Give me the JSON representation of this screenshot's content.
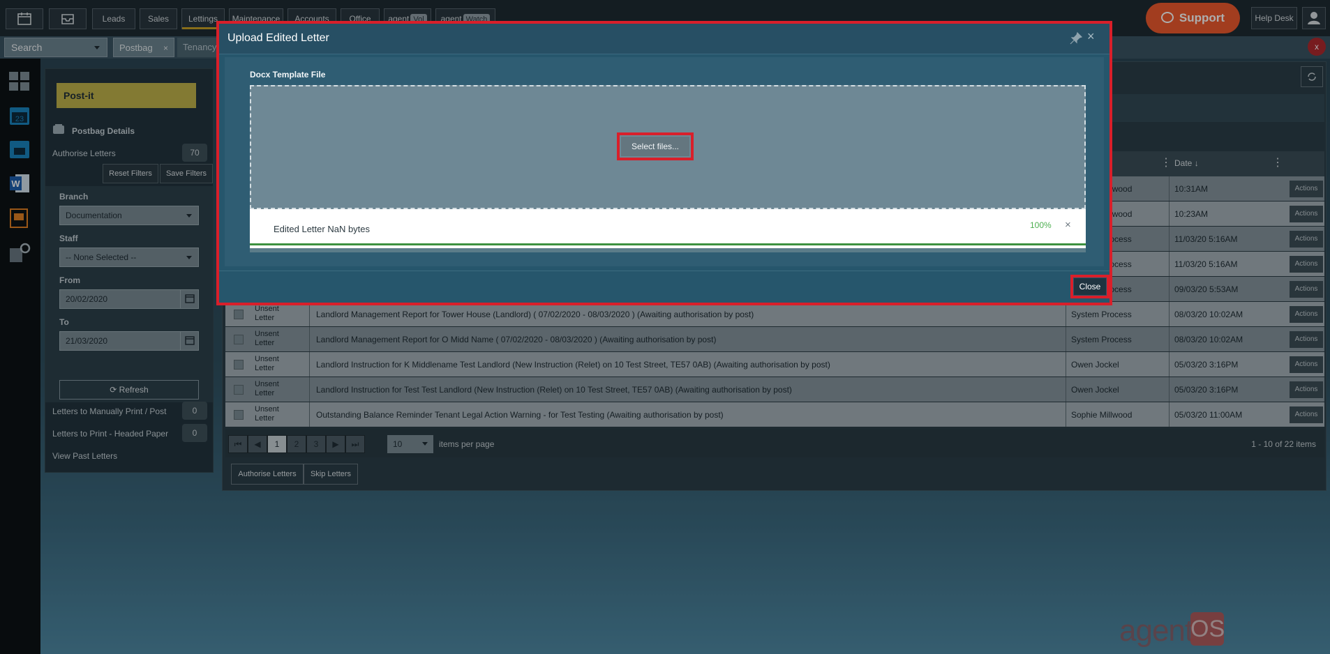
{
  "topnav": {
    "items": [
      {
        "label": ""
      },
      {
        "label": ""
      },
      {
        "label": "Leads"
      },
      {
        "label": "Sales"
      },
      {
        "label": "Lettings"
      },
      {
        "label": "Maintenance"
      },
      {
        "label": "Accounts"
      },
      {
        "label": "Office"
      },
      {
        "label": "agent",
        "pill": "Vol"
      },
      {
        "label": "agent",
        "pill": "Watch"
      }
    ],
    "support_label": "Support",
    "helpdesk_label": "Help Desk"
  },
  "tabbar": {
    "search_label": "Search",
    "tabs": [
      {
        "label": "Postbag",
        "close": "×"
      },
      {
        "label": "Tenancy"
      }
    ],
    "close_all": "x"
  },
  "leftpanel": {
    "postit_label": "Post-it",
    "section_title": "Postbag Details",
    "authorise_label": "Authorise Letters",
    "authorise_count": "70",
    "reset_filters": "Reset Filters",
    "save_filters": "Save Filters",
    "filters": {
      "branch_label": "Branch",
      "branch_value": "Documentation",
      "staff_label": "Staff",
      "staff_value": "-- None Selected --",
      "from_label": "From",
      "from_value": "20/02/2020",
      "to_label": "To",
      "to_value": "21/03/2020",
      "refresh_label": "Refresh"
    },
    "manual_print_label": "Letters to Manually Print / Post",
    "manual_print_count": "0",
    "headed_paper_label": "Letters to Print - Headed Paper",
    "headed_paper_count": "0",
    "past_letters_label": "View Past Letters"
  },
  "grid": {
    "date_header": "Date",
    "rows": [
      {
        "status": "",
        "desc": "",
        "by": "Sophie Millwood",
        "date": "10:31AM",
        "action": "Actions"
      },
      {
        "status": "",
        "desc": "",
        "by": "Sophie Millwood",
        "date": "10:23AM",
        "action": "Actions"
      },
      {
        "status": "",
        "desc": "",
        "by": "System Process",
        "date": "11/03/20 5:16AM",
        "action": "Actions"
      },
      {
        "status": "",
        "desc": "",
        "by": "System Process",
        "date": "11/03/20 5:16AM",
        "action": "Actions"
      },
      {
        "status": "",
        "desc": "",
        "by": "System Process",
        "date": "09/03/20 5:53AM",
        "action": "Actions"
      },
      {
        "status": "Unsent Letter",
        "desc": "Landlord Management Report for Tower House (Landlord) ( 07/02/2020 - 08/03/2020 ) (Awaiting authorisation by post)",
        "by": "System Process",
        "date": "08/03/20 10:02AM",
        "action": "Actions"
      },
      {
        "status": "Unsent Letter",
        "desc": "Landlord Management Report for O Midd Name ( 07/02/2020 - 08/03/2020 ) (Awaiting authorisation by post)",
        "by": "System Process",
        "date": "08/03/20 10:02AM",
        "action": "Actions"
      },
      {
        "status": "Unsent Letter",
        "desc": "Landlord Instruction for K Middlename Test Landlord (New Instruction (Relet) on 10 Test Street, TE57 0AB) (Awaiting authorisation by post)",
        "by": "Owen Jockel",
        "date": "05/03/20 3:16PM",
        "action": "Actions"
      },
      {
        "status": "Unsent Letter",
        "desc": "Landlord Instruction for Test Test Landlord (New Instruction (Relet) on 10 Test Street, TE57 0AB) (Awaiting authorisation by post)",
        "by": "Owen Jockel",
        "date": "05/03/20 3:16PM",
        "action": "Actions"
      },
      {
        "status": "Unsent Letter",
        "desc": "Outstanding Balance Reminder Tenant Legal Action Warning - for Test Testing (Awaiting authorisation by post)",
        "by": "Sophie Millwood",
        "date": "05/03/20 11:00AM",
        "action": "Actions"
      }
    ],
    "pager": {
      "pages": [
        "1",
        "2",
        "3"
      ],
      "per_page": "10",
      "per_page_label": "items per page",
      "summary": "1 - 10 of 22 items"
    },
    "authorise_btn": "Authorise Letters",
    "skip_btn": "Skip Letters"
  },
  "logo": {
    "word": "agent",
    "os": "OS"
  },
  "modal": {
    "title": "Upload Edited Letter",
    "close_x": "×",
    "field_label": "Docx Template File",
    "select_files": "Select files...",
    "file_name": "Edited Letter NaN bytes",
    "file_progress": 1.0,
    "file_progress_text": "100%",
    "file_remove": "×",
    "close_label": "Close"
  },
  "colors": {
    "support": "#ef5b2e",
    "highlight_border": "#d91f2a",
    "postit": "#c1b44c",
    "progress": "#3d9140"
  }
}
